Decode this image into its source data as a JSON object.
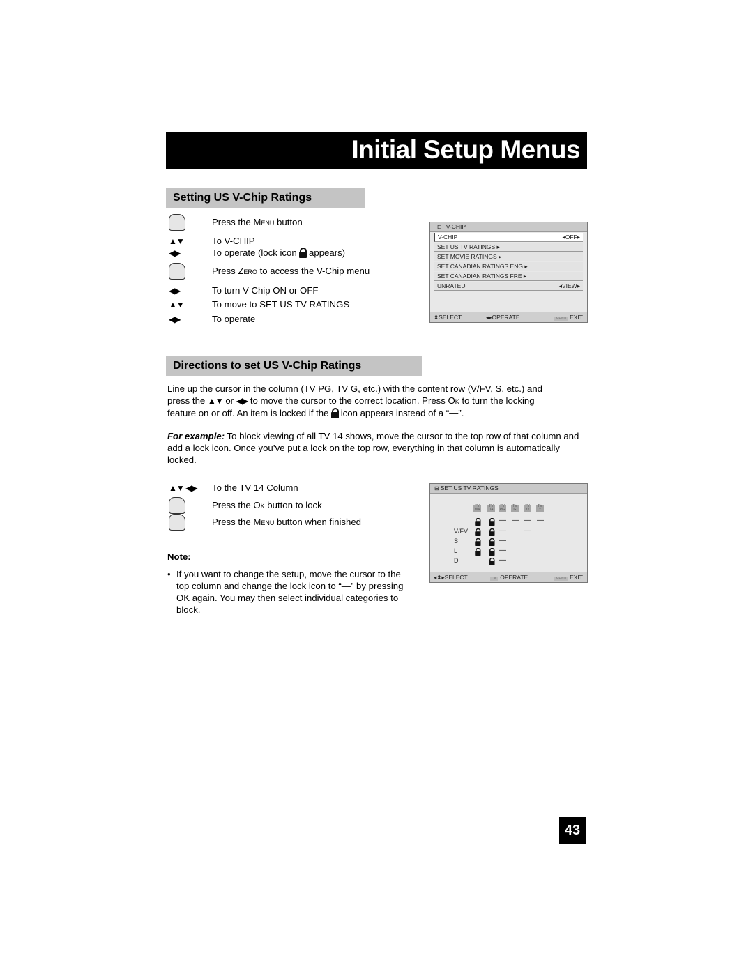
{
  "page_title": "Initial Setup Menus",
  "section1": {
    "heading": "Setting US V-Chip Ratings",
    "steps": [
      {
        "icon": "hand-press-icon",
        "pre": "Press the ",
        "sc": "Menu",
        "post": " button"
      },
      {
        "icon": "up-down-arrows-icon",
        "text": "To V-CHIP"
      },
      {
        "icon": "left-right-arrows-icon",
        "pre": "To operate (lock icon ",
        "post": " appears)"
      },
      {
        "icon": "hand-press-icon",
        "pre": "Press ",
        "sc": "Zero",
        "post": " to access the V-Chip menu"
      },
      {
        "icon": "left-right-arrows-icon",
        "text": "To turn V-Chip ON or OFF"
      },
      {
        "icon": "up-down-arrows-icon",
        "text": "To move to SET US TV RATINGS"
      },
      {
        "icon": "left-right-arrows-icon",
        "text": "To operate"
      }
    ],
    "arrows_ud": "▲▼",
    "arrows_lr": "◀▶"
  },
  "vchip_screen": {
    "header": "V-CHIP",
    "rows": [
      {
        "label": "V-CHIP",
        "value": "OFF"
      },
      {
        "label": "SET US TV RATINGS"
      },
      {
        "label": "SET MOVIE RATINGS"
      },
      {
        "label": "SET CANADIAN RATINGS ENG"
      },
      {
        "label": "SET CANADIAN RATINGS FRE"
      },
      {
        "label": "UNRATED",
        "value": "VIEW"
      }
    ],
    "footer": {
      "select": "SELECT",
      "operate": "OPERATE",
      "menu": "MENU",
      "exit": "EXIT"
    }
  },
  "section2": {
    "heading": "Directions to set US V-Chip Ratings",
    "para1": {
      "line1": "Line up the cursor in the column (TV PG, TV G, etc.) with the content row (V/FV, S, etc.) and",
      "line2_a": "press the ",
      "line2_b": " or ",
      "line2_c": " to move the cursor to the correct location. Press ",
      "line2_sc": "Ok",
      "line2_d": " to turn the locking",
      "line3_a": "feature on or off. An item is locked if the ",
      "line3_b": " icon appears instead of a “—”."
    },
    "para2": {
      "lead": "For example:",
      "text": " To block viewing of all TV 14 shows, move the cursor to the top row of that column and add a lock icon. Once you’ve put a lock on the top row, everything in that column is automatically locked."
    },
    "steps": [
      {
        "icon": "arrows-icon",
        "text": "To the TV 14 Column"
      },
      {
        "icon": "hand-press-icon",
        "pre": "Press the ",
        "sc": "Ok",
        "post": " button to lock"
      },
      {
        "icon": "hand-press-icon",
        "pre": "Press the ",
        "sc": "Menu",
        "post": " button when finished"
      }
    ],
    "note_label": "Note:",
    "note_text": "If you want to change the setup, move the cursor to the top column and change the lock icon to “—” by pressing OK again. You may then select individual categories to block."
  },
  "ratings_screen": {
    "header": "SET US TV RATINGS",
    "columns": [
      "TV MA",
      "TV 14",
      "TV PG",
      "TV G",
      "TV Y7",
      "TV Y"
    ],
    "rows": [
      {
        "label": "",
        "cells": [
          "lock",
          "lock",
          "—",
          "—",
          "—",
          "—"
        ]
      },
      {
        "label": "V/FV",
        "cells": [
          "lock",
          "lock",
          "—",
          "",
          "—",
          ""
        ]
      },
      {
        "label": "S",
        "cells": [
          "lock",
          "lock",
          "—",
          "",
          "",
          ""
        ]
      },
      {
        "label": "L",
        "cells": [
          "lock",
          "lock",
          "—",
          "",
          "",
          ""
        ]
      },
      {
        "label": "D",
        "cells": [
          "",
          "lock",
          "—",
          "",
          "",
          ""
        ]
      }
    ],
    "footer": {
      "select": "SELECT",
      "ok": "OK",
      "operate": "OPERATE",
      "menu": "MENU",
      "exit": "EXIT"
    }
  },
  "page_number": "43"
}
